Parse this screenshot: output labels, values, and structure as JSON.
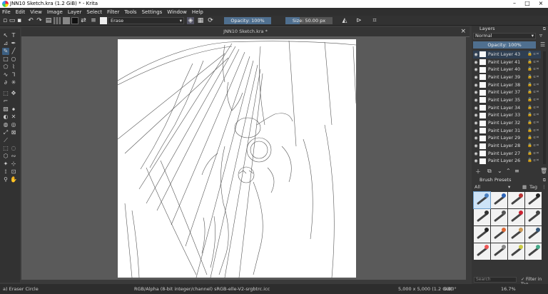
{
  "window": {
    "title": "JNN10 Sketch.kra (1.2 GiB) * - Krita",
    "controls": [
      "–",
      "□",
      "×"
    ]
  },
  "menu": [
    "File",
    "Edit",
    "View",
    "Image",
    "Layer",
    "Select",
    "Filter",
    "Tools",
    "Settings",
    "Window",
    "Help"
  ],
  "toolbar": {
    "blend_mode": "Erase",
    "opacity_label": "Opacity: 100%",
    "opacity_value": 1.0,
    "size_label": "Size: 50.00 px",
    "size_fill": 0.3
  },
  "document": {
    "tab_title": "JNN10 Sketch.kra *",
    "close": "×"
  },
  "status": {
    "brush": "a) Eraser Circle",
    "color_info": "RGB/Alpha (8-bit integer/channel)  sRGB-elle-V2-srgbtrc.icc",
    "dimensions": "5,000 x 5,000 (1.2 GiB)",
    "rotation": "0.00°",
    "zoom": "16.7%"
  },
  "layers_panel": {
    "title": "Layers",
    "blend_mode": "Normal",
    "opacity_label": "Opacity: 100%",
    "layers": [
      "Paint Layer 43",
      "Paint Layer 41",
      "Paint Layer 40",
      "Paint Layer 39",
      "Paint Layer 38",
      "Paint Layer 37",
      "Paint Layer 35",
      "Paint Layer 34",
      "Paint Layer 33",
      "Paint Layer 32",
      "Paint Layer 31",
      "Paint Layer 29",
      "Paint Layer 28",
      "Paint Layer 27",
      "Paint Layer 26"
    ]
  },
  "brush_presets": {
    "title": "Brush Presets",
    "filter": "All",
    "tag": "Tag",
    "search_placeholder": "Search",
    "filter_in_tag": "Filter in Tag",
    "colors": [
      "#4a7fc0",
      "#2b63b8",
      "#b33",
      "#222",
      "#333",
      "#555",
      "#c23",
      "#444",
      "#222",
      "#d63",
      "#c95",
      "#357",
      "#e55",
      "#888",
      "#cc4",
      "#4a8"
    ]
  },
  "accent": "#4f6f8f"
}
